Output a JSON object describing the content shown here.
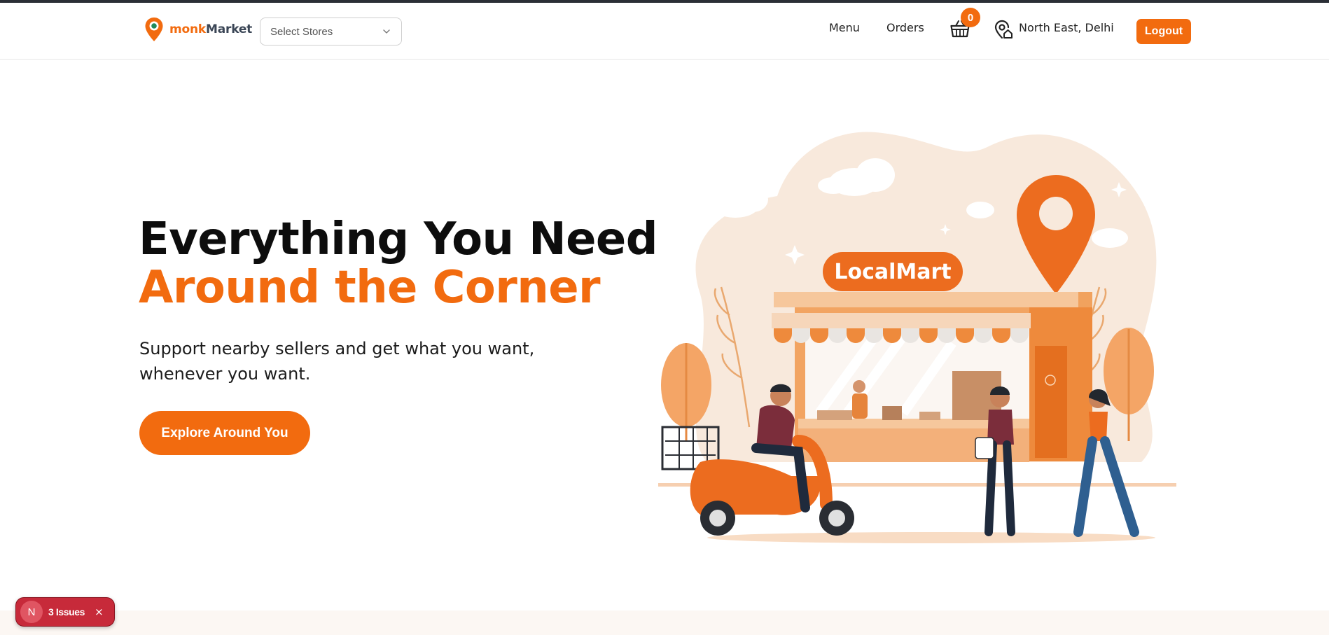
{
  "brand": {
    "name_part1": "monk",
    "name_part2": "Market"
  },
  "store_select": {
    "placeholder": "Select Stores"
  },
  "nav": {
    "menu": "Menu",
    "orders": "Orders",
    "cart_count": "0",
    "location": "North East, Delhi",
    "logout": "Logout"
  },
  "hero": {
    "title_line1": "Everything You Need",
    "title_line2": "Around the Corner",
    "subtitle_line1": "Support nearby sellers and get what you want,",
    "subtitle_line2": "whenever you want.",
    "cta": "Explore Around You"
  },
  "illustration": {
    "shop_sign": "LocalMart"
  },
  "issues_badge": {
    "icon": "N",
    "label": "3 Issues",
    "close": "×"
  },
  "colors": {
    "accent": "#f26b0f",
    "issues_red": "#c72a3a"
  }
}
